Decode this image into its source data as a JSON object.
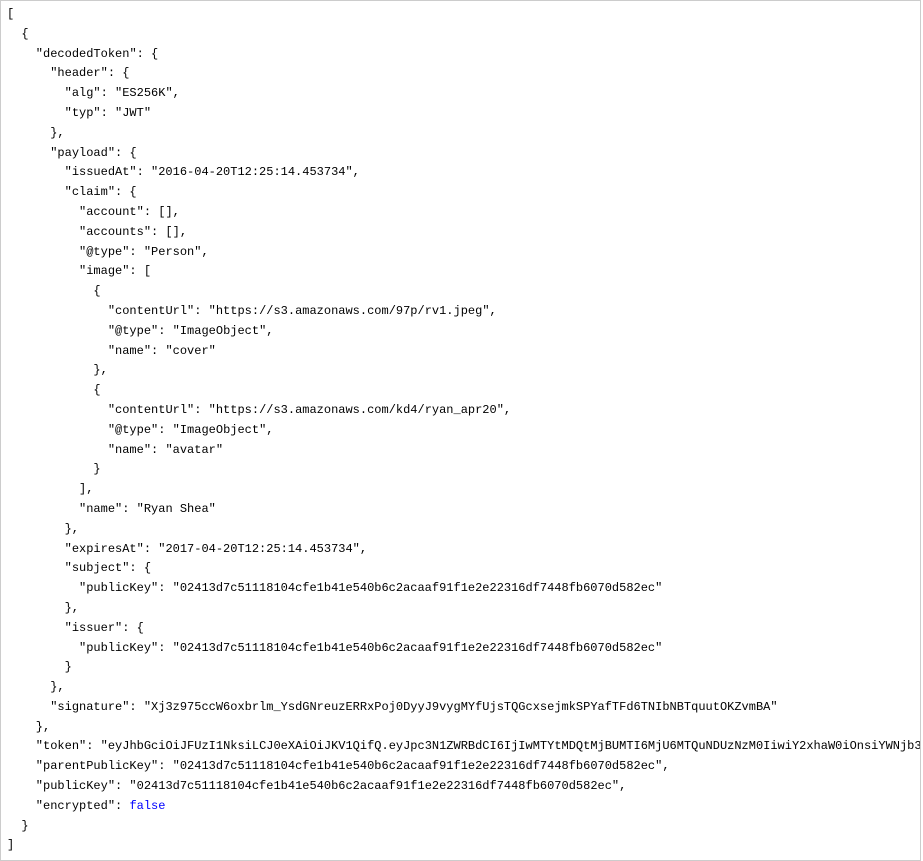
{
  "json": {
    "decodedToken": {
      "header": {
        "alg": "ES256K",
        "typ": "JWT"
      },
      "payload": {
        "issuedAt": "2016-04-20T12:25:14.453734",
        "claim": {
          "account": [],
          "accounts": [],
          "@type": "Person",
          "image": [
            {
              "contentUrl": "https://s3.amazonaws.com/97p/rv1.jpeg",
              "@type": "ImageObject",
              "name": "cover"
            },
            {
              "contentUrl": "https://s3.amazonaws.com/kd4/ryan_apr20",
              "@type": "ImageObject",
              "name": "avatar"
            }
          ],
          "name": "Ryan Shea"
        },
        "expiresAt": "2017-04-20T12:25:14.453734",
        "subject": {
          "publicKey": "02413d7c51118104cfe1b41e540b6c2acaaf91f1e2e22316df7448fb6070d582ec"
        },
        "issuer": {
          "publicKey": "02413d7c51118104cfe1b41e540b6c2acaaf91f1e2e22316df7448fb6070d582ec"
        }
      },
      "signature": "Xj3z975ccW6oxbrlm_YsdGNreuzERRxPoj0DyyJ9vygMYfUjsTQGcxsejmkSPYafTFd6TNIbNBTquutOKZvmBA"
    },
    "token": "eyJhbGciOiJFUzI1NksiLCJ0eXAiOiJKV1QifQ.eyJpc3N1ZWRBdCI6IjIwMTYtMDQtMjBUMTI6MjU6MTQuNDUzNzM0IiwiY2xhaW0iOnsiYWNjb3",
    "parentPublicKey": "02413d7c51118104cfe1b41e540b6c2acaaf91f1e2e22316df7448fb6070d582ec",
    "publicKey": "02413d7c51118104cfe1b41e540b6c2acaaf91f1e2e22316df7448fb6070d582ec",
    "encrypted": false
  },
  "labels": {
    "decodedToken": "decodedToken",
    "header": "header",
    "alg": "alg",
    "typ": "typ",
    "payload": "payload",
    "issuedAt": "issuedAt",
    "claim": "claim",
    "account": "account",
    "accounts": "accounts",
    "atType": "@type",
    "image": "image",
    "contentUrl": "contentUrl",
    "name": "name",
    "expiresAt": "expiresAt",
    "subject": "subject",
    "publicKey": "publicKey",
    "issuer": "issuer",
    "signature": "signature",
    "token": "token",
    "parentPublicKey": "parentPublicKey",
    "encrypted": "encrypted"
  }
}
